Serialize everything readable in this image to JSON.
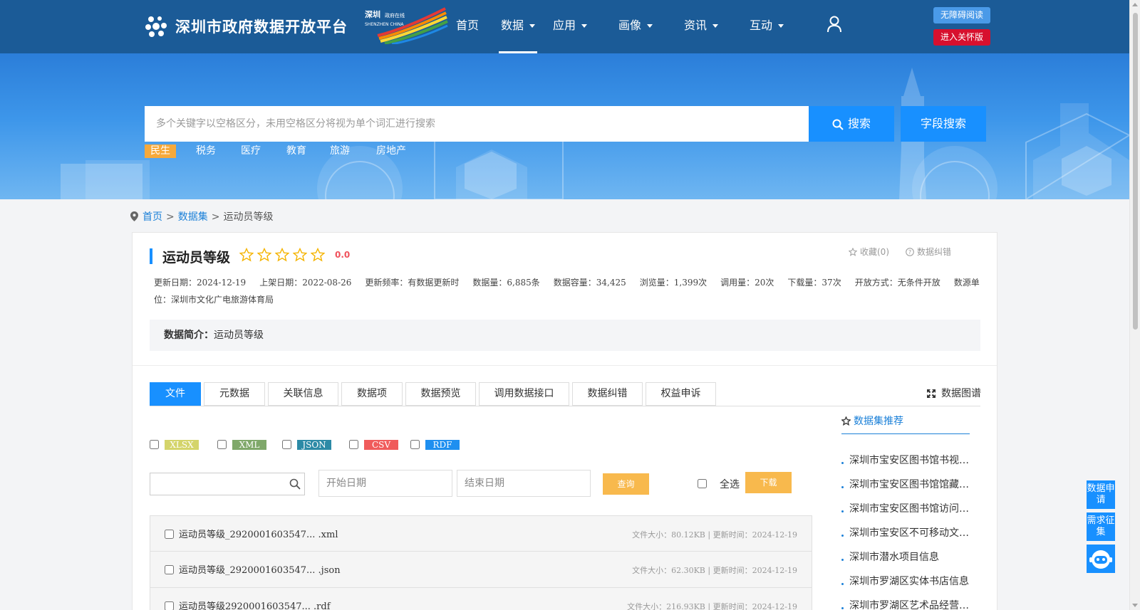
{
  "header": {
    "site_title": "深圳市政府数据开放平台",
    "brand_logo_text": "深圳政府在线 SHENZHEN CHINA",
    "nav": [
      {
        "label": "首页",
        "dropdown": false,
        "active": false
      },
      {
        "label": "数据",
        "dropdown": true,
        "active": true
      },
      {
        "label": "应用",
        "dropdown": true,
        "active": false
      },
      {
        "label": "画像",
        "dropdown": true,
        "active": false
      },
      {
        "label": "资讯",
        "dropdown": true,
        "active": false
      },
      {
        "label": "互动",
        "dropdown": true,
        "active": false
      }
    ],
    "accessibility_label": "无障碍阅读",
    "elder_mode_label": "进入关怀版",
    "accessibility_color": "#4a9ae8",
    "elder_mode_color": "#d7102e"
  },
  "search": {
    "placeholder": "多个关键字以空格区分，未用空格区分将视为单个词汇进行搜索",
    "value": "",
    "search_label": "搜索",
    "field_search_label": "字段搜索",
    "hot_tags": [
      {
        "label": "民生",
        "active": true
      },
      {
        "label": "税务",
        "active": false
      },
      {
        "label": "医疗",
        "active": false
      },
      {
        "label": "教育",
        "active": false
      },
      {
        "label": "旅游",
        "active": false
      },
      {
        "label": "房地产",
        "active": false
      }
    ]
  },
  "breadcrumb": {
    "home": "首页",
    "datasets": "数据集",
    "current": "运动员等级",
    "separator": ">"
  },
  "dataset": {
    "title": "运动员等级",
    "rating": "0.0",
    "rating_stars": 0,
    "rating_max": 5,
    "favorite_label": "收藏(0)",
    "report_label": "数据纠错",
    "meta": [
      "更新日期：2024-12-19",
      "上架日期：2022-08-26",
      "更新频率：有数据更新时",
      "数据量：6,885条",
      "数据容量：34,425",
      "浏览量：1,399次",
      "调用量：20次",
      "下载量：37次",
      "开放方式：无条件开放",
      "数源单位：深圳市文化广电旅游体育局"
    ],
    "summary_label": "数据简介：",
    "summary_text": "运动员等级"
  },
  "tabs": [
    {
      "label": "文件",
      "active": true
    },
    {
      "label": "元数据",
      "active": false
    },
    {
      "label": "关联信息",
      "active": false
    },
    {
      "label": "数据项",
      "active": false
    },
    {
      "label": "数据预览",
      "active": false
    },
    {
      "label": "调用数据接口",
      "active": false
    },
    {
      "label": "数据纠错",
      "active": false
    },
    {
      "label": "权益申诉",
      "active": false
    }
  ],
  "graph_label": "数据图谱",
  "formats": [
    {
      "label": "XLSX",
      "color": "#d4d46a"
    },
    {
      "label": "XML",
      "color": "#7fa86a"
    },
    {
      "label": "JSON",
      "color": "#2c8aa6"
    },
    {
      "label": "CSV",
      "color": "#f05b5b"
    },
    {
      "label": "RDF",
      "color": "#1e8ff0"
    }
  ],
  "filters": {
    "file_search_value": "",
    "start_date_placeholder": "开始日期",
    "end_date_placeholder": "结束日期",
    "query_label": "查询",
    "select_all_label": "全选",
    "download_label": "下载"
  },
  "files": [
    {
      "name": "运动员等级_2920001603547... .xml",
      "info": "文件大小：80.12KB | 更新时间：2024-12-19"
    },
    {
      "name": "运动员等级_2920001603547... .json",
      "info": "文件大小：62.30KB | 更新时间：2024-12-19"
    },
    {
      "name": "运动员等级2920001603547... .rdf",
      "info": "文件大小：216.93KB | 更新时间：2024-12-19"
    }
  ],
  "recommendations": {
    "title": "数据集推荐",
    "items": [
      "深圳市宝安区图书馆书视听资源信息",
      "深圳市宝安区图书馆馆藏资源信息",
      "深圳市宝安区图书馆访问量信息",
      "深圳市宝安区不可移动文物信息",
      "深圳市潜水项目信息",
      "深圳市罗湖区实体书店信息",
      "深圳市罗湖区艺术品经营单位信息"
    ]
  },
  "side_float": {
    "apply_label": "数据申请",
    "request_label": "需求征集"
  }
}
